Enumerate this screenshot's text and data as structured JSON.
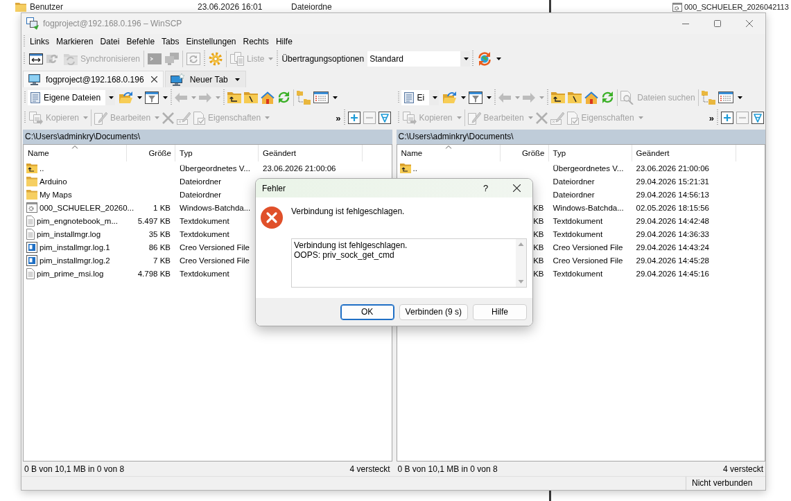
{
  "background": {
    "rows": [
      {
        "name": "Benutzer",
        "modified": "23.06.2026 16:01",
        "type": "Dateiordne"
      }
    ],
    "side_item": "000_SCHUELER_2026042113"
  },
  "window": {
    "title": "fogproject@192.168.0.196 – WinSCP",
    "active": false
  },
  "menu": [
    "Links",
    "Markieren",
    "Datei",
    "Befehle",
    "Tabs",
    "Einstellungen",
    "Rechts",
    "Hilfe"
  ],
  "toolbar": {
    "compare": {
      "disabled": false
    },
    "keep_up_to_date": {
      "disabled": true
    },
    "synchronize": {
      "label": "Synchronisieren",
      "disabled": true
    },
    "terminal": {
      "disabled": true
    },
    "putty": {
      "disabled": true
    },
    "queue": {
      "disabled": true
    },
    "preferences": {
      "disabled": false
    },
    "file_list": {
      "label": "Liste",
      "disabled": true
    },
    "transfer_settings": {
      "label": "Übertragungsoptionen",
      "value": "Standard"
    },
    "connect": {
      "disabled": false
    }
  },
  "tabs": [
    {
      "kind": "session",
      "label": "fogproject@192.168.0.196",
      "selected": true
    },
    {
      "kind": "new",
      "label": "Neuer Tab",
      "selected": false
    }
  ],
  "panels": [
    {
      "toolbar": {
        "location": {
          "value": "Eigene Dateien"
        },
        "open_directory": {
          "disabled": false
        },
        "filter": {
          "disabled": false
        },
        "back": {
          "disabled": true
        },
        "forward": {
          "disabled": true
        },
        "parent_directory": {
          "disabled": false
        },
        "root_directory": {
          "disabled": false
        },
        "home_directory": {
          "disabled": false
        },
        "refresh": {
          "disabled": false
        },
        "tree": {
          "disabled": false
        },
        "view": {
          "disabled": false
        }
      },
      "actions": {
        "copy": {
          "label": "Kopieren",
          "disabled": true
        },
        "edit": {
          "label": "Bearbeiten",
          "disabled": true
        },
        "delete": {
          "disabled": true
        },
        "rename": {
          "disabled": true
        },
        "properties": {
          "label": "Eigenschaften",
          "disabled": true
        },
        "more": "»",
        "select": {
          "disabled": false
        },
        "unselect": {
          "disabled": true
        },
        "select_all": {
          "disabled": false
        }
      },
      "path": "C:\\Users\\adminkry\\Documents\\",
      "columns": [
        {
          "label": "Name",
          "sorted": true
        },
        {
          "label": "Größe",
          "sorted": false
        },
        {
          "label": "Typ",
          "sorted": false
        },
        {
          "label": "Geändert",
          "sorted": false
        }
      ],
      "rows": [
        {
          "kind": "parent",
          "name": "..",
          "type": "Übergeordnetes V...",
          "modified": "23.06.2026 21:00:06"
        },
        {
          "kind": "folder",
          "name": "Arduino",
          "type": "Dateiordner"
        },
        {
          "kind": "folder",
          "name": "My Maps",
          "type": "Dateiordner"
        },
        {
          "kind": "batch",
          "name": "000_SCHUELER_20260...",
          "size": "1 KB",
          "type": "Windows-Batchda..."
        },
        {
          "kind": "text",
          "name": "pim_engnotebook_m...",
          "size": "5.497 KB",
          "type": "Textdokument"
        },
        {
          "kind": "text",
          "name": "pim_installmgr.log",
          "size": "35 KB",
          "type": "Textdokument"
        },
        {
          "kind": "creo",
          "name": "pim_installmgr.log.1",
          "size": "86 KB",
          "type": "Creo Versioned File"
        },
        {
          "kind": "creo",
          "name": "pim_installmgr.log.2",
          "size": "7 KB",
          "type": "Creo Versioned File"
        },
        {
          "kind": "text",
          "name": "pim_prime_msi.log",
          "size": "4.798 KB",
          "type": "Textdokument"
        }
      ],
      "status": {
        "summary": "0 B von 10,1 MB in 0 von 8",
        "hidden": "4 versteckt"
      }
    },
    {
      "toolbar": {
        "location": {
          "value": "Ei"
        },
        "open_directory": {
          "disabled": false
        },
        "filter": {
          "disabled": false
        },
        "back": {
          "disabled": true
        },
        "forward": {
          "disabled": true
        },
        "parent_directory": {
          "disabled": false
        },
        "root_directory": {
          "disabled": false
        },
        "home_directory": {
          "disabled": false
        },
        "refresh": {
          "disabled": false
        },
        "find_files": {
          "label": "Dateien suchen",
          "disabled": true
        },
        "tree": {
          "disabled": false
        },
        "view": {
          "disabled": false
        }
      },
      "actions": {
        "copy": {
          "label": "Kopieren",
          "disabled": true
        },
        "edit": {
          "label": "Bearbeiten",
          "disabled": true
        },
        "delete": {
          "disabled": true
        },
        "rename": {
          "disabled": true
        },
        "properties": {
          "label": "Eigenschaften",
          "disabled": true
        },
        "more": "»",
        "select": {
          "disabled": false
        },
        "unselect": {
          "disabled": true
        },
        "select_all": {
          "disabled": false
        }
      },
      "path": "C:\\Users\\adminkry\\Documents\\",
      "columns": [
        {
          "label": "Name",
          "sorted": true
        },
        {
          "label": "Größe",
          "sorted": false
        },
        {
          "label": "Typ",
          "sorted": false
        },
        {
          "label": "Geändert",
          "sorted": false
        }
      ],
      "rows": [
        {
          "kind": "parent",
          "name": "..",
          "type": "Übergeordnetes V...",
          "modified": "23.06.2026 21:00:06"
        },
        {
          "type": "Dateiordner",
          "modified": "29.04.2026 15:21:31"
        },
        {
          "type": "Dateiordner",
          "modified": "29.04.2026 14:56:13"
        },
        {
          "size": "KB",
          "type": "Windows-Batchda...",
          "modified": "02.05.2026 18:15:56"
        },
        {
          "size": "KB",
          "type": "Textdokument",
          "modified": "29.04.2026 14:42:48"
        },
        {
          "size": "KB",
          "type": "Textdokument",
          "modified": "29.04.2026 14:36:33"
        },
        {
          "size": "KB",
          "type": "Creo Versioned File",
          "modified": "29.04.2026 14:43:24"
        },
        {
          "size": "KB",
          "type": "Creo Versioned File",
          "modified": "29.04.2026 14:45:28"
        },
        {
          "size": "KB",
          "type": "Textdokument",
          "modified": "29.04.2026 14:45:16"
        }
      ],
      "status": {
        "summary": "0 B von 10,1 MB in 0 von 8",
        "hidden": "4 versteckt"
      }
    }
  ],
  "status_bar": {
    "connection": "Nicht verbunden"
  },
  "dialog": {
    "title": "Fehler",
    "help": "?",
    "message": "Verbindung ist fehlgeschlagen.",
    "details": [
      "Verbindung ist fehlgeschlagen.",
      "OOPS: priv_sock_get_cmd"
    ],
    "buttons": [
      {
        "label": "OK",
        "default": true
      },
      {
        "label": "Verbinden (9 s)",
        "default": false
      },
      {
        "label": "Hilfe",
        "default": false
      }
    ]
  }
}
